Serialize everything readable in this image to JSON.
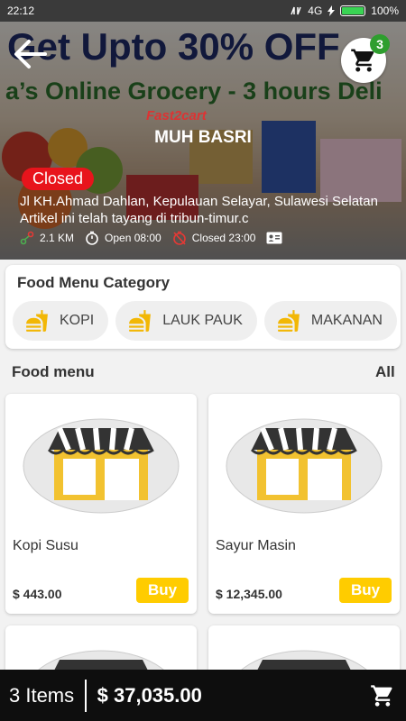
{
  "status_bar": {
    "time": "22:12",
    "network": "4G",
    "battery": "100%"
  },
  "hero": {
    "banner_line1": "Get Upto 30% OFF",
    "banner_line2": "a’s Online Grocery - 3 hours Deli",
    "logo_text": "Fast2cart",
    "store_name": "MUH BASRI",
    "status": "Closed",
    "address": "Jl KH.Ahmad Dahlan, Kepulauan Selayar, Sulawesi Selatan",
    "description": "Artikel ini telah tayang di tribun-timur.c",
    "distance": "2.1 KM",
    "open_time": "Open 08:00",
    "close_time": "Closed 23:00",
    "cart_count": "3"
  },
  "category": {
    "title": "Food Menu Category",
    "items": [
      {
        "label": "KOPI"
      },
      {
        "label": "LAUK PAUK"
      },
      {
        "label": "MAKANAN"
      }
    ]
  },
  "menu": {
    "title": "Food menu",
    "all_label": "All",
    "products": [
      {
        "name": "Kopi Susu",
        "price": "$ 443.00",
        "buy_label": "Buy"
      },
      {
        "name": "Sayur Masin",
        "price": "$ 12,345.00",
        "buy_label": "Buy"
      }
    ]
  },
  "bottom_bar": {
    "items": "3 Items",
    "total": "$ 37,035.00"
  },
  "colors": {
    "closed_red": "#e8141c",
    "buy_yellow": "#ffcc00",
    "badge_green": "#2e9e2e",
    "bar_dark": "#0e0e0e"
  }
}
